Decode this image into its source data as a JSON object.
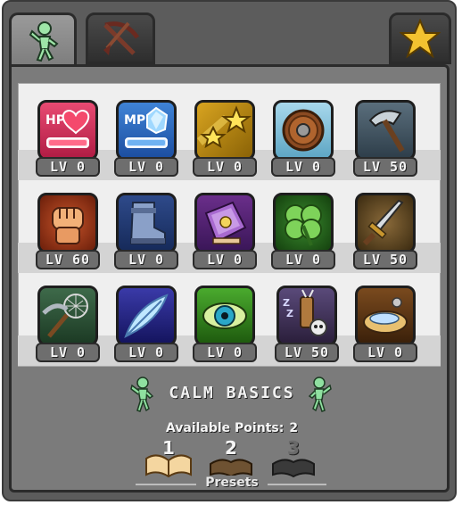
{
  "tabs": [
    {
      "name": "stats-tab",
      "icon": "runner-figure-icon",
      "active": true
    },
    {
      "name": "equipment-tab",
      "icon": "crossbow-icon",
      "active": false
    },
    {
      "name": "favorites-tab",
      "icon": "star-icon",
      "active": false
    }
  ],
  "skills": [
    [
      {
        "icon": "hp-heart-icon",
        "badge": "HP",
        "level": "LV 0"
      },
      {
        "icon": "mp-crystal-icon",
        "badge": "MP",
        "level": "LV 0"
      },
      {
        "icon": "shooting-stars-icon",
        "level": "LV 0"
      },
      {
        "icon": "round-shield-icon",
        "level": "LV 0"
      },
      {
        "icon": "hatchet-icon",
        "level": "LV 50"
      }
    ],
    [
      {
        "icon": "fist-icon",
        "level": "LV 60"
      },
      {
        "icon": "boot-icon",
        "level": "LV 0"
      },
      {
        "icon": "spellbook-icon",
        "level": "LV 0"
      },
      {
        "icon": "clover-icon",
        "level": "LV 0"
      },
      {
        "icon": "sword-icon",
        "level": "LV 50"
      }
    ],
    [
      {
        "icon": "net-and-pickaxe-icon",
        "level": "LV 0"
      },
      {
        "icon": "feather-icon",
        "level": "LV 0"
      },
      {
        "icon": "dragon-eye-icon",
        "level": "LV 0"
      },
      {
        "icon": "sleep-quiver-skull-icon",
        "level": "LV 50"
      },
      {
        "icon": "bread-platter-icon",
        "level": "LV 0"
      }
    ]
  ],
  "preset": {
    "title": "CALM BASICS"
  },
  "available_points": {
    "label": "Available Points:",
    "value": "2"
  },
  "presets": {
    "label": "Presets",
    "slots": [
      {
        "number": "1",
        "state": "selected"
      },
      {
        "number": "2",
        "state": "unselected"
      },
      {
        "number": "3",
        "state": "locked"
      }
    ]
  },
  "colors": {
    "panel": "#5c5c5c",
    "content": "#7b7b7b",
    "grid": "#efefef",
    "star": "#f2c230",
    "mascot": "#8fe0a0"
  }
}
